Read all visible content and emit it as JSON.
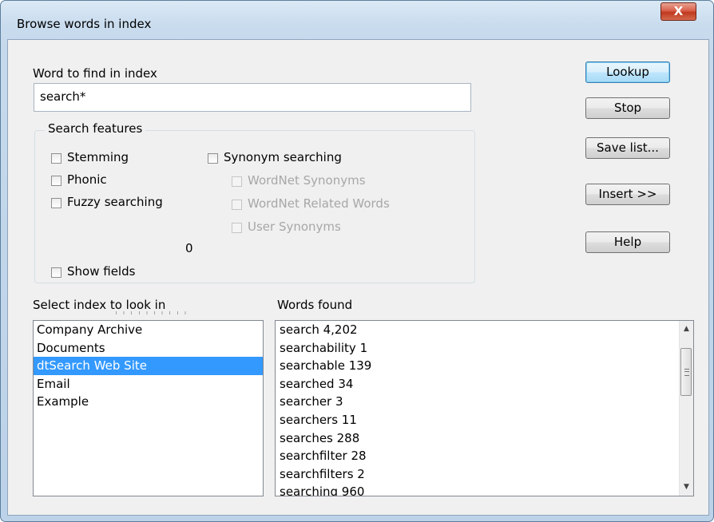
{
  "window": {
    "title": "Browse words in index",
    "close_glyph": "X"
  },
  "word_field": {
    "label": "Word to find in index",
    "value": "search*"
  },
  "search_features": {
    "legend": "Search features",
    "stemming": {
      "label": "Stemming",
      "checked": false
    },
    "phonic": {
      "label": "Phonic",
      "checked": false
    },
    "fuzzy": {
      "label": "Fuzzy searching",
      "checked": false
    },
    "fuzziness": {
      "value": "0",
      "level": 0
    },
    "show_fields": {
      "label": "Show fields",
      "checked": false
    },
    "synonym": {
      "label": "Synonym searching",
      "checked": false
    },
    "wordnet_synonyms": {
      "label": "WordNet Synonyms",
      "checked": false,
      "disabled": true
    },
    "wordnet_related": {
      "label": "WordNet Related Words",
      "checked": false,
      "disabled": true
    },
    "user_synonyms": {
      "label": "User Synonyms",
      "checked": false,
      "disabled": true
    }
  },
  "buttons": {
    "lookup": "Lookup",
    "stop": "Stop",
    "save_list": "Save list...",
    "insert": "Insert >>",
    "help": "Help"
  },
  "index_list": {
    "label": "Select index to look in",
    "items": [
      "Company Archive",
      "Documents",
      "dtSearch Web Site",
      "Email",
      "Example"
    ],
    "selected": "dtSearch Web Site"
  },
  "words_found": {
    "label": "Words found",
    "items": [
      "search 4,202",
      "searchability 1",
      "searchable 139",
      "searched 34",
      "searcher 3",
      "searchers 11",
      "searches 288",
      "searchfilter 28",
      "searchfilters 2",
      "searching 960"
    ]
  },
  "colors": {
    "selection": "#3399ff",
    "close_button": "#c0391f"
  }
}
